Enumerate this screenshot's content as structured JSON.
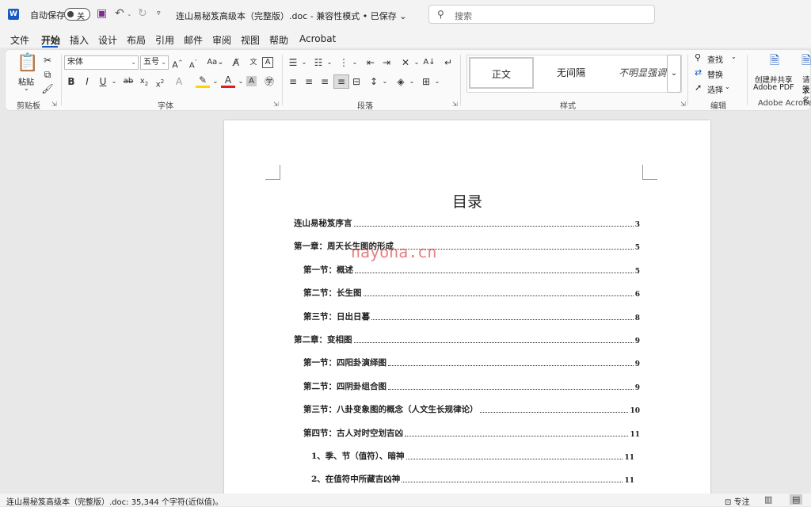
{
  "window": {
    "autosave_label": "自动保存",
    "autosave_state": "关",
    "doc_title": "连山易秘笈高级本（完整版）.doc - 兼容性模式 • 已保存 ⌄",
    "search_placeholder": "搜索"
  },
  "tabs": [
    "文件",
    "开始",
    "插入",
    "设计",
    "布局",
    "引用",
    "邮件",
    "审阅",
    "视图",
    "帮助",
    "Acrobat"
  ],
  "active_tab": "开始",
  "ribbon": {
    "clipboard": {
      "paste_label": "粘贴",
      "group_label": "剪贴板"
    },
    "font": {
      "font_name": "宋体",
      "font_size": "五号",
      "group_label": "字体"
    },
    "paragraph": {
      "group_label": "段落"
    },
    "styles": {
      "items": [
        "正文",
        "无间隔",
        "不明显强调"
      ],
      "group_label": "样式"
    },
    "editing": {
      "find": "查找",
      "replace": "替换",
      "select": "选择",
      "group_label": "编辑"
    },
    "adobe": {
      "create_share_line1": "创建并共享",
      "create_share_line2": "Adobe PDF",
      "request_line1": "请求",
      "request_line2": "签名",
      "group_label": "Adobe Acrobat"
    }
  },
  "document": {
    "toc_title": "目录",
    "toc": [
      {
        "text": "连山易秘笈序言",
        "page": "3",
        "level": 0
      },
      {
        "text": "第一章：周天长生图的形成",
        "page": "5",
        "level": 0
      },
      {
        "text": "第一节：概述",
        "page": "5",
        "level": 1
      },
      {
        "text": "第二节：长生图",
        "page": "6",
        "level": 1
      },
      {
        "text": "第三节：日出日暮",
        "page": "8",
        "level": 1
      },
      {
        "text": "第二章：变相图",
        "page": "9",
        "level": 0
      },
      {
        "text": "第一节：四阳卦演绎图",
        "page": "9",
        "level": 1
      },
      {
        "text": "第二节：四阴卦组合图",
        "page": "9",
        "level": 1
      },
      {
        "text": "第三节：八卦变象图的概念（人文生长规律论）",
        "page": "10",
        "level": 1
      },
      {
        "text": "第四节：古人对时空划吉凶",
        "page": "11",
        "level": 1
      },
      {
        "text": "1、季、节（值符）、暗神",
        "page": "11",
        "level": 2
      },
      {
        "text": "2、在值符中所藏吉凶神",
        "page": "11",
        "level": 2
      }
    ],
    "watermark": "nayona.cn"
  },
  "status": {
    "text": "连山易秘笈高级本（完整版）.doc: 35,344 个字符(近似值)。",
    "focus": "专注"
  }
}
